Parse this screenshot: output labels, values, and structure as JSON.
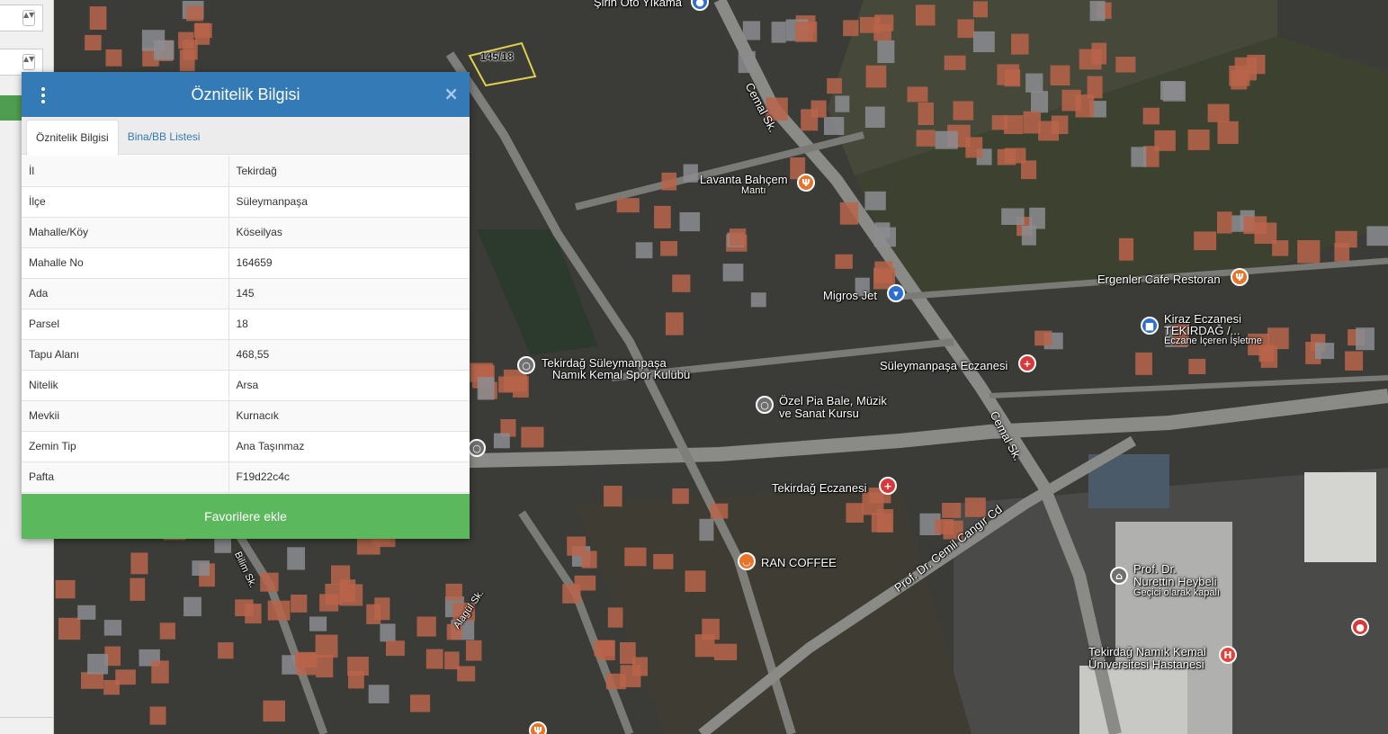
{
  "panel": {
    "title": "Öznitelik Bilgisi",
    "tabs": [
      {
        "label": "Öznitelik Bilgisi",
        "active": true
      },
      {
        "label": "Bina/BB Listesi",
        "active": false
      }
    ],
    "rows": [
      {
        "key": "İl",
        "value": "Tekirdağ"
      },
      {
        "key": "İlçe",
        "value": "Süleymanpaşa"
      },
      {
        "key": "Mahalle/Köy",
        "value": "Köseilyas"
      },
      {
        "key": "Mahalle No",
        "value": "164659"
      },
      {
        "key": "Ada",
        "value": "145"
      },
      {
        "key": "Parsel",
        "value": "18"
      },
      {
        "key": "Tapu Alanı",
        "value": "468,55"
      },
      {
        "key": "Nitelik",
        "value": "Arsa"
      },
      {
        "key": "Mevkii",
        "value": "Kurnacık"
      },
      {
        "key": "Zemin Tip",
        "value": "Ana Taşınmaz"
      },
      {
        "key": "Pafta",
        "value": "F19d22c4c"
      }
    ],
    "favorite_button": "Favorilere ekle",
    "close_glyph": "×",
    "menu_icon": "vertical-dots-icon"
  },
  "map": {
    "parcel_label": "145/18",
    "streets": {
      "cemal_1": "Cemal Sk.",
      "cemal_2": "Cemal Sk.",
      "prof_dr": "Prof. Dr. Cemil Cangır Cd",
      "bilim": "Bilim Sk.",
      "alagul": "Alagül Sk."
    },
    "places": {
      "sirin": "Şirin Oto Yıkama",
      "lavanta_1": "Lavanta Bahçem",
      "lavanta_2": "Mantı",
      "migros": "Migros Jet",
      "ergenler": "Ergenler Cafe Restoran",
      "kiraz_1": "Kiraz Eczanesi",
      "kiraz_2": "TEKİRDAĞ /...",
      "kiraz_3": "Eczane İçeren İşletme",
      "spor_1": "Tekirdağ Süleymanpaşa",
      "spor_2": "Namık Kemal Spor Kulübü",
      "suley_ecz": "Süleymanpaşa Eczanesi",
      "pia_1": "Özel Pia Bale, Müzik",
      "pia_2": "ve Sanat Kursu",
      "tek_ecz": "Tekirdağ Eczanesi",
      "ran": "RAN COFFEE",
      "heybeli_1": "Prof. Dr.",
      "heybeli_2": "Nurettin Heybeli",
      "heybeli_3": "Geçici olarak kapalı",
      "hastane_1": "Tekirdağ Namık Kemal",
      "hastane_2": "Üniversitesi Hastanesi"
    },
    "colors": {
      "road": "#8a8a86",
      "roof": "#b8644a",
      "vegetation": "#3d4a2e",
      "field": "#4a4a38"
    }
  },
  "sidebar": {
    "select_arrows": "▲▼",
    "accent": "#4f9e4f"
  }
}
